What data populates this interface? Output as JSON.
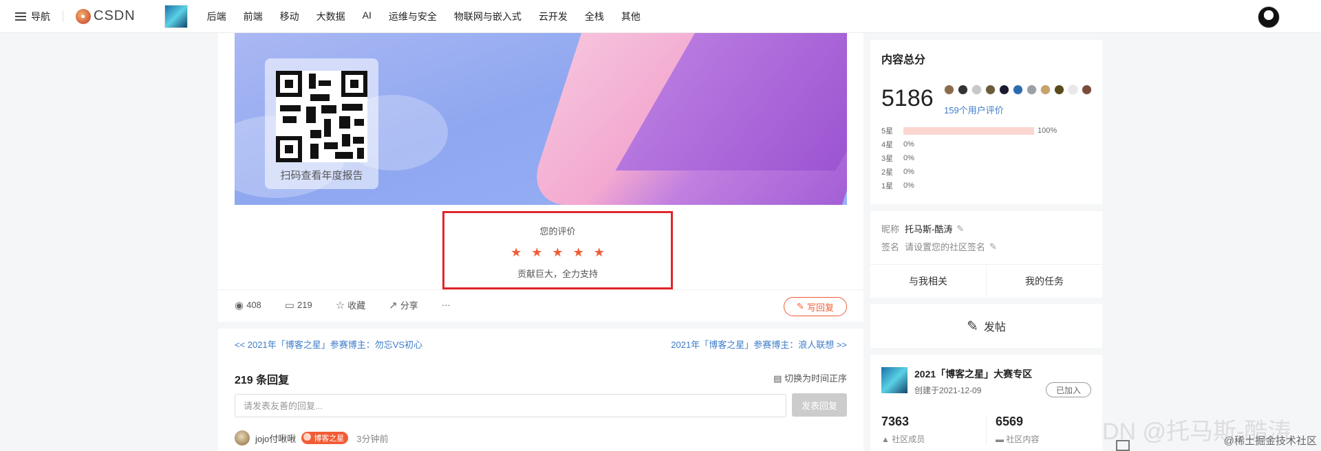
{
  "nav": {
    "toggle_label": "导航",
    "logo_text": "CSDN",
    "menu": [
      "后端",
      "前端",
      "移动",
      "大数据",
      "AI",
      "运维与安全",
      "物联网与嵌入式",
      "云开发",
      "全栈",
      "其他"
    ]
  },
  "banner": {
    "qr_caption": "扫码查看年度报告"
  },
  "rating": {
    "title": "您的评价",
    "stars": 5,
    "star_glyphs": "★★★★★",
    "text": "贡献巨大，全力支持"
  },
  "actions": {
    "views": "408",
    "comments": "219",
    "favorite": "收藏",
    "share": "分享",
    "more": "···",
    "reply": "写回复"
  },
  "pager": {
    "prev": "<<   2021年「博客之星」参赛博主：勿忘VS初心",
    "next": "2021年「博客之星」参赛博主：浪人联想   >>"
  },
  "replies": {
    "count": "219 条回复",
    "sort": "切换为时间正序",
    "placeholder": "请发表友善的回复...",
    "publish": "发表回复"
  },
  "comment": {
    "user": "jojo付啾啾",
    "badge": "博客之星",
    "time": "3分钟前"
  },
  "score": {
    "title": "内容总分",
    "total": "5186",
    "eval_count": "159个用户评价",
    "avatar_colors": [
      "#8b6b4a",
      "#333333",
      "#c8c8c8",
      "#6b5b3b",
      "#1a1a2e",
      "#2b6cb0",
      "#9aa0a6",
      "#c8a26b",
      "#5a4a1a",
      "#e8e8e8",
      "#7a4a3a"
    ],
    "distribution": [
      {
        "label": "5星",
        "percent": "100%",
        "fraction": 1.0
      },
      {
        "label": "4星",
        "percent": "0%",
        "fraction": 0
      },
      {
        "label": "3星",
        "percent": "0%",
        "fraction": 0
      },
      {
        "label": "2星",
        "percent": "0%",
        "fraction": 0
      },
      {
        "label": "1星",
        "percent": "0%",
        "fraction": 0
      }
    ]
  },
  "profile": {
    "nickname_key": "昵称",
    "nickname": "托马斯-酷涛",
    "sign_key": "签名",
    "sign": "请设置您的社区签名",
    "tab_related": "与我相关",
    "tab_tasks": "我的任务"
  },
  "post": {
    "label": "发帖"
  },
  "community": {
    "title": "2021「博客之星」大赛专区",
    "date": "创建于2021-12-09",
    "joined": "已加入",
    "members_count": "7363",
    "members_label": "社区成员",
    "content_count": "6569",
    "content_label": "社区内容"
  },
  "watermark": {
    "large": "DN @托马斯-酷涛",
    "small": "@稀土掘金技术社区"
  },
  "colors": {
    "accent": "#f15c36",
    "link": "#3d7cc9",
    "highlight_border": "#e0262a"
  }
}
